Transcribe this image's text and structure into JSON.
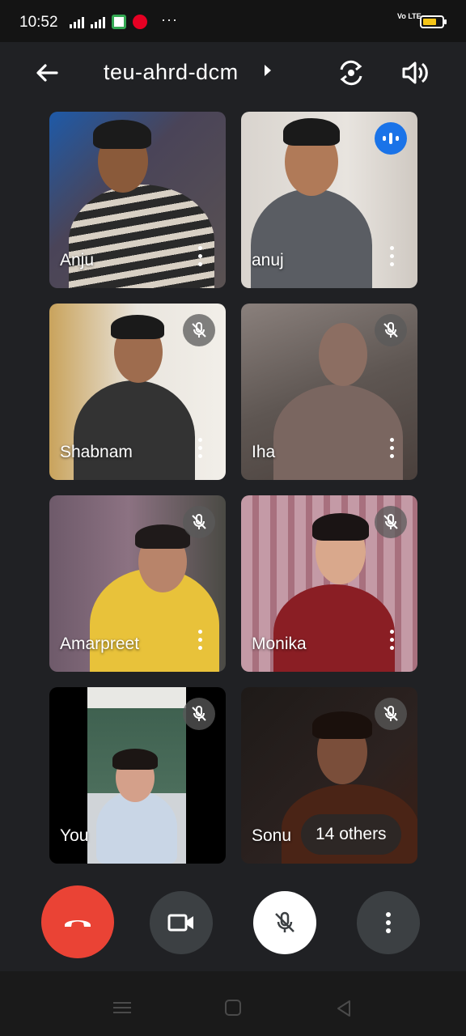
{
  "status_bar": {
    "time": "10:52",
    "network": "4G",
    "volte": "Vo LTE",
    "icons": [
      "signal-icon",
      "signal-icon",
      "meet-app-icon",
      "pinterest-icon",
      "more-dots",
      "battery-icon"
    ]
  },
  "header": {
    "meeting_code": "teu-ahrd-dcm",
    "back_icon": "arrow-left-icon",
    "switch_camera_icon": "switch-camera-icon",
    "audio_icon": "speaker-icon"
  },
  "participants": [
    {
      "name": "Anju",
      "muted": false,
      "speaking": false
    },
    {
      "name": "anuj",
      "muted": false,
      "speaking": true
    },
    {
      "name": "Shabnam",
      "muted": true,
      "speaking": false
    },
    {
      "name": "Iha",
      "muted": true,
      "speaking": false
    },
    {
      "name": "Amarpreet",
      "muted": true,
      "speaking": false
    },
    {
      "name": "Monika",
      "muted": true,
      "speaking": false
    },
    {
      "name": "You",
      "muted": true,
      "speaking": false
    },
    {
      "name": "Sonu",
      "muted": true,
      "speaking": false
    }
  ],
  "others_label": "14 others",
  "controls": {
    "end_call_icon": "end-call-icon",
    "camera_icon": "video-camera-icon",
    "mic_icon": "mic-off-icon",
    "more_icon": "more-vert-icon"
  },
  "colors": {
    "background": "#202124",
    "end_call": "#ea4335",
    "control_bg": "#3c4043",
    "speaking_badge": "#1a73e8"
  }
}
